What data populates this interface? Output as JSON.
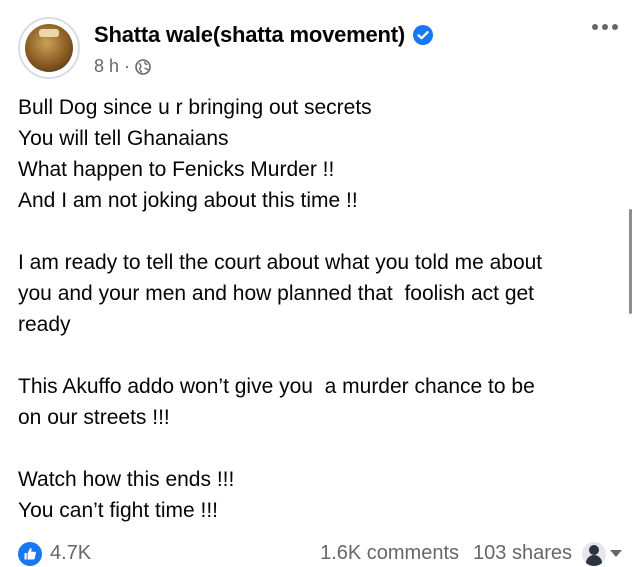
{
  "post": {
    "author": "Shatta wale(shatta movement)",
    "time": "8 h",
    "separator": "·",
    "lines": [
      "Bull Dog since u r bringing out secrets",
      "You will tell Ghanaians",
      "What happen to Fenicks Murder !!",
      "And I am not joking about this time !!",
      "",
      "I am ready to tell the court about what you told me about",
      "you and your men and how planned that  foolish act get",
      "ready",
      "",
      "This Akuffo addo won’t give you  a murder chance to be",
      "on our streets !!!",
      "",
      "Watch how this ends !!!",
      "You can’t fight time !!!"
    ]
  },
  "footer": {
    "likes": "4.7K",
    "comments": "1.6K comments",
    "shares": "103 shares"
  },
  "icons": {
    "verified": "verified-badge-icon",
    "globe": "globe-icon",
    "more": "more-icon",
    "like": "like-icon"
  },
  "colors": {
    "verified_blue": "#1877f2",
    "like_blue": "#1877f2",
    "secondary_text": "#65676b"
  }
}
